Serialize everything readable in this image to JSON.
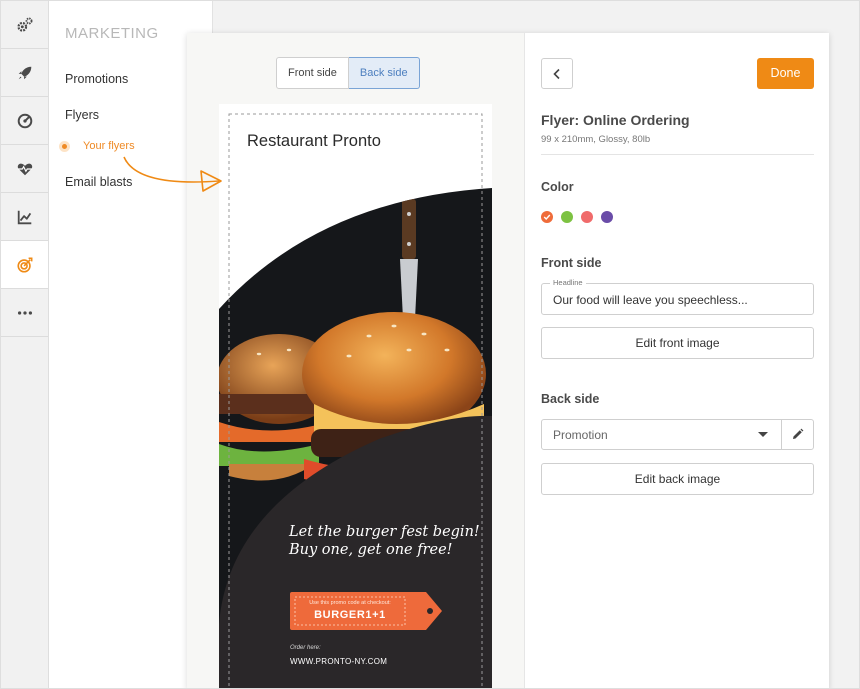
{
  "rail": {
    "items": [
      {
        "icon": "gears-icon"
      },
      {
        "icon": "rocket-icon"
      },
      {
        "icon": "gauge-icon"
      },
      {
        "icon": "heart-pulse-icon"
      },
      {
        "icon": "line-chart-icon"
      },
      {
        "icon": "target-icon",
        "active": true
      },
      {
        "icon": "more-icon"
      }
    ]
  },
  "subnav": {
    "title": "MARKETING",
    "promotions": "Promotions",
    "flyers": "Flyers",
    "your_flyers": "Your flyers",
    "email_blasts": "Email blasts"
  },
  "editor": {
    "front_side_tab": "Front side",
    "back_side_tab": "Back side",
    "active_tab": "Back side"
  },
  "flyer": {
    "restaurant_name": "Restaurant Pronto",
    "tagline_1": "Let the burger fest begin!",
    "tagline_2": "Buy one, get one free!",
    "promo_hint": "Use this promo code at checkout:",
    "promo_code": "BURGER1+1",
    "order_label": "Order here:",
    "order_url": "WWW.PRONTO-NY.COM"
  },
  "panel": {
    "done_label": "Done",
    "title": "Flyer: Online Ordering",
    "subtitle": "99 x 210mm, Glossy, 80lb",
    "color_heading": "Color",
    "colors": [
      "#ef6c3a",
      "#7dc242",
      "#f06b6b",
      "#6a4ca8"
    ],
    "selected_color": "#ef6c3a",
    "front_heading": "Front side",
    "headline_label": "Headline",
    "headline_value": "Our food will leave you speechless...",
    "edit_front_label": "Edit front image",
    "back_heading": "Back side",
    "back_select_value": "Promotion",
    "edit_back_label": "Edit back image"
  },
  "colors": {
    "accent": "#ef8a15",
    "promo": "#ee6a3b",
    "dark_panel": "#2a2729"
  }
}
